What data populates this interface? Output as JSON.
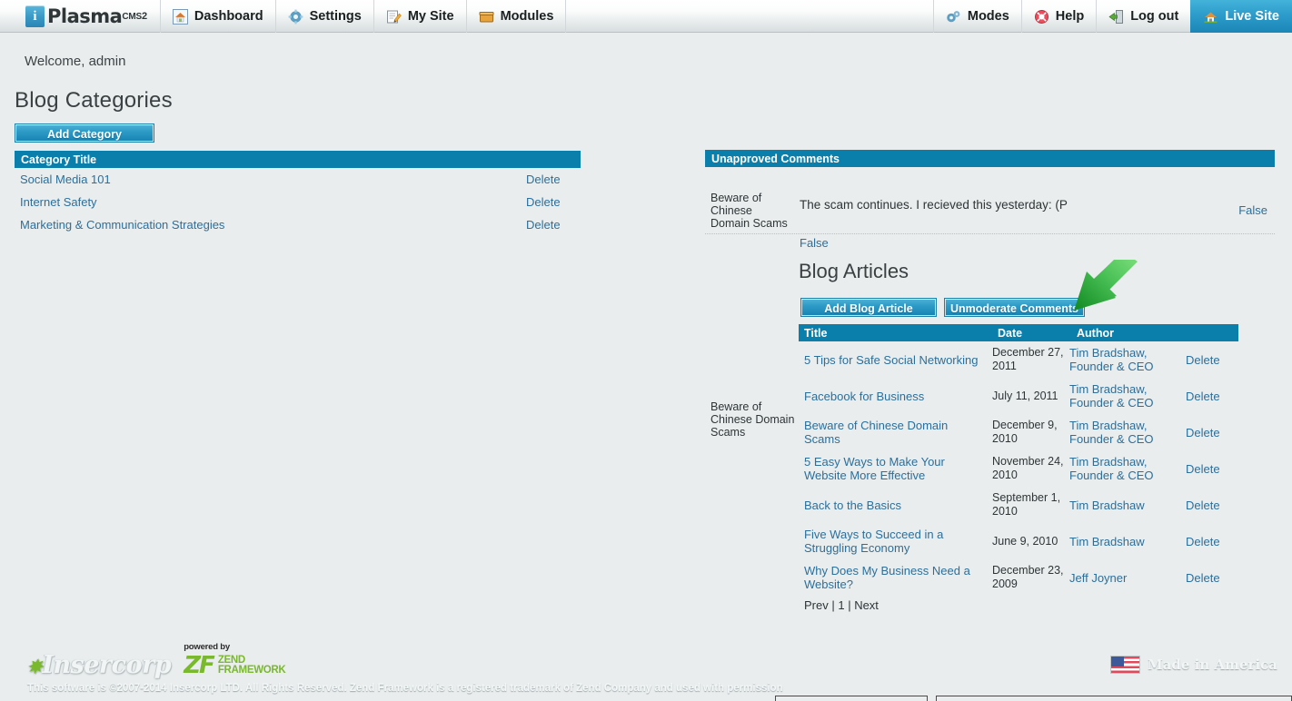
{
  "topnav": {
    "logo": {
      "letter": "i",
      "name": "Plasma",
      "sup": "CMS",
      "sup_num": "2"
    },
    "left_items": [
      {
        "label": "Dashboard",
        "icon": "home-icon"
      },
      {
        "label": "Settings",
        "icon": "gear-icon"
      },
      {
        "label": "My Site",
        "icon": "pencil-note-icon"
      },
      {
        "label": "Modules",
        "icon": "box-icon"
      }
    ],
    "right_items": [
      {
        "label": "Modes",
        "icon": "gears-icon"
      },
      {
        "label": "Help",
        "icon": "lifering-icon"
      },
      {
        "label": "Log out",
        "icon": "exit-door-icon"
      }
    ],
    "live_site": {
      "label": "Live Site",
      "icon": "home-icon"
    }
  },
  "welcome": "Welcome, admin",
  "page_title": "Blog Categories",
  "categories": {
    "add_button": "Add Category",
    "header": "Category Title",
    "delete_label": "Delete",
    "rows": [
      {
        "title": "Social Media 101"
      },
      {
        "title": "Internet Safety"
      },
      {
        "title": "Marketing & Communication Strategies"
      }
    ]
  },
  "unapproved": {
    "header": "Unapproved Comments",
    "rows": [
      {
        "article": "Beware of Chinese Domain Scams",
        "body": "The scam continues.  I recieved this yesterday:  (P",
        "approve_label": "False",
        "status_label": "False"
      }
    ]
  },
  "orphan_label": "Beware of Chinese Domain Scams",
  "articles": {
    "title": "Blog Articles",
    "add_button": "Add Blog Article",
    "unmoderate_button": "Unmoderate Comments",
    "columns": {
      "title": "Title",
      "date": "Date",
      "author": "Author"
    },
    "delete_label": "Delete",
    "rows": [
      {
        "title": "5 Tips for Safe Social Networking",
        "date": "December 27, 2011",
        "author": "Tim Bradshaw, Founder & CEO"
      },
      {
        "title": "Facebook for Business",
        "date": "July 11, 2011",
        "author": "Tim Bradshaw, Founder & CEO"
      },
      {
        "title": "Beware of Chinese Domain Scams",
        "date": "December 9, 2010",
        "author": "Tim Bradshaw, Founder & CEO"
      },
      {
        "title": "5 Easy Ways to Make Your Website More Effective",
        "date": "November 24, 2010",
        "author": "Tim Bradshaw, Founder & CEO"
      },
      {
        "title": "Back to the Basics",
        "date": "September 1, 2010",
        "author": "Tim Bradshaw"
      },
      {
        "title": "Five Ways to Succeed in a Struggling Economy",
        "date": "June 9, 2010",
        "author": "Tim Bradshaw"
      },
      {
        "title": "Why Does My Business Need a Website?",
        "date": "December 23, 2009",
        "author": "Jeff Joyner"
      }
    ],
    "pager": {
      "prev": "Prev",
      "sep1": " | ",
      "current": "1",
      "sep2": " | ",
      "next": "Next"
    }
  },
  "annotation": {
    "type": "arrow",
    "color": "#2fa33c",
    "points_to": "unmoderate-comments-button"
  },
  "footer": {
    "insercorp": "Insercorp",
    "zend_powered": "powered by",
    "zend_mark": "ZF",
    "zend_word1": "ZEND",
    "zend_word2": "FRAMEWORK",
    "copyright": "This software is ©2007-2014 Insercorp LTD. All Rights Reserved. Zend Framework is a registered trademark of Zend Company and used with permission",
    "made_in_america": "Made in America"
  },
  "colors": {
    "accent_blue": "#0b7fab",
    "link_blue": "#2c6f9a",
    "page_bg": "#e9edee",
    "arrow_green": "#2fa33c"
  }
}
